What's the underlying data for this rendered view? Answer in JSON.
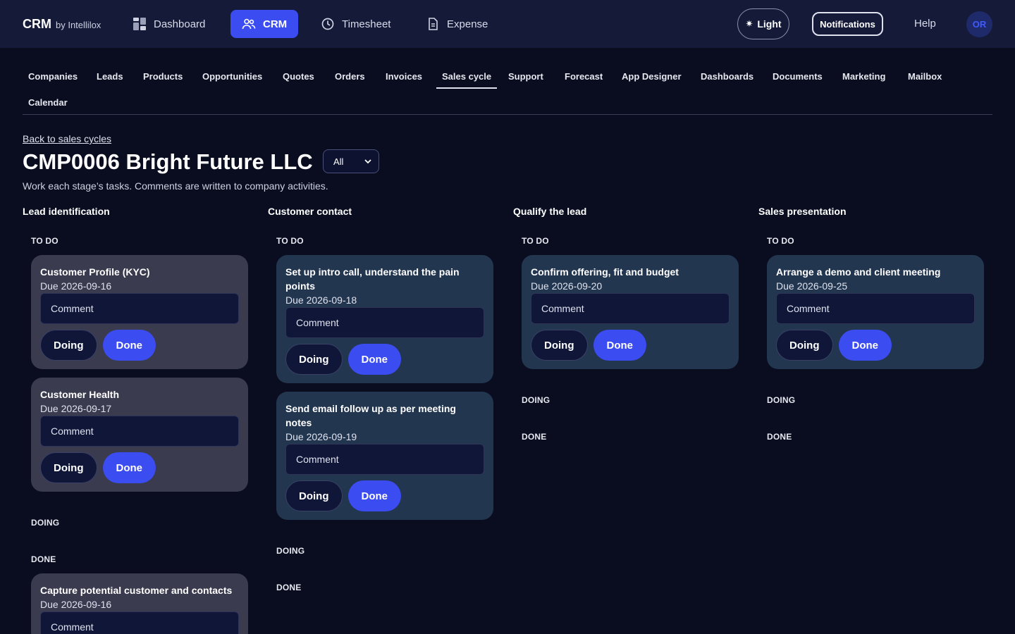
{
  "header": {
    "brand": "CRM",
    "brand_sub": "by Intellilox",
    "nav": [
      {
        "label": "Dashboard",
        "icon": "dashboard-icon"
      },
      {
        "label": "CRM",
        "icon": "users-icon"
      },
      {
        "label": "Timesheet",
        "icon": "clock-icon"
      },
      {
        "label": "Expense",
        "icon": "document-icon"
      }
    ],
    "theme_label": "Light",
    "notifications_label": "Notifications",
    "help_label": "Help",
    "avatar_initials": "OR"
  },
  "subnav": [
    "Companies",
    "Leads",
    "Products",
    "Opportunities",
    "Quotes",
    "Orders",
    "Invoices",
    "Sales cycle",
    "Support",
    "Forecast",
    "App Designer",
    "Dashboards",
    "Documents",
    "Marketing",
    "Mailbox",
    "Calendar"
  ],
  "page": {
    "back_link": "Back to sales cycles",
    "title": "CMP0006 Bright Future LLC",
    "filter_value": "All",
    "description": "Work each stage’s tasks. Comments are written to company activities."
  },
  "labels": {
    "todo": "TO DO",
    "doing": "DOING",
    "done": "DONE",
    "comment_placeholder": "Comment",
    "doing_button": "Doing",
    "done_button": "Done"
  },
  "columns": [
    {
      "title": "Lead identification",
      "todo": [
        {
          "title": "Customer Profile (KYC)",
          "due": "Due 2026-09-16"
        },
        {
          "title": "Customer Health",
          "due": "Due 2026-09-17"
        }
      ],
      "done": [
        {
          "title": "Capture potential customer and contacts",
          "due": "Due 2026-09-16"
        }
      ]
    },
    {
      "title": "Customer contact",
      "todo": [
        {
          "title": "Set up intro call, understand the pain points",
          "due": "Due 2026-09-18"
        },
        {
          "title": "Send email follow up as per meeting notes",
          "due": "Due 2026-09-19"
        }
      ]
    },
    {
      "title": "Qualify the lead",
      "todo": [
        {
          "title": "Confirm offering, fit and budget",
          "due": "Due 2026-09-20"
        }
      ]
    },
    {
      "title": "Sales presentation",
      "todo": [
        {
          "title": "Arrange a demo and client meeting",
          "due": "Due 2026-09-25"
        }
      ]
    }
  ]
}
